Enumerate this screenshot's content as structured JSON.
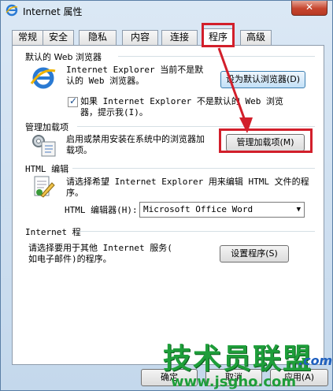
{
  "window": {
    "title": "Internet 属性",
    "close_label": "✕"
  },
  "tabs": [
    {
      "label": "常规"
    },
    {
      "label": "安全"
    },
    {
      "label": "隐私"
    },
    {
      "label": "内容"
    },
    {
      "label": "连接"
    },
    {
      "label": "程序",
      "active": true
    },
    {
      "label": "高级"
    }
  ],
  "default_browser": {
    "title": "默认的 Web 浏览器",
    "line1": "Internet Explorer 当前不是默",
    "line2": "认的 Web 浏览器。",
    "button": "设为默认浏览器(D)",
    "checkbox_line1": "如果 Internet Explorer 不是默认的 Web 浏览",
    "checkbox_line2": "器，提示我(I)。",
    "checkbox_checked": true
  },
  "addons": {
    "title": "管理加载项",
    "line1": "启用或禁用安装在系统中的浏览器加",
    "line2": "载项。",
    "button": "管理加载项(M)"
  },
  "html_editor": {
    "title": "HTML 编辑",
    "line1": "请选择希望 Internet Explorer 用来编辑 HTML 文件的程",
    "line2": "序。",
    "select_label": "HTML 编辑器(H):",
    "select_value": "Microsoft Office Word"
  },
  "internet_programs": {
    "title": "Internet 程",
    "line1": "请选择要用于其他 Internet 服务(",
    "line2": "如电子邮件)的程序。",
    "button": "设置程序(S)"
  },
  "footer": {
    "ok": "确定",
    "cancel": "取消",
    "apply": "应用(A)"
  },
  "watermark": {
    "text": "技术员联盟",
    "url": "www.jsgho.com",
    "suffix": ".com"
  },
  "colors": {
    "highlight_red": "#d21f2b",
    "watermark_green": "#1e9e3a",
    "watermark_blue": "#1d5fbf"
  }
}
